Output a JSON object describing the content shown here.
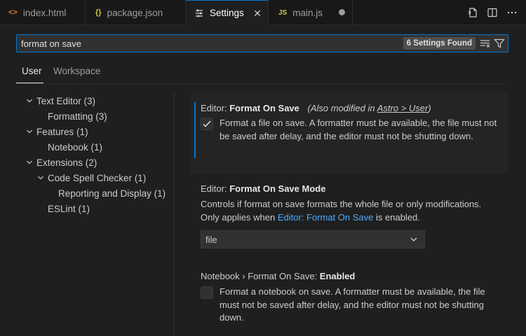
{
  "tabs": [
    {
      "label": "index.html",
      "icon": "<>",
      "icon_color": "#e37933"
    },
    {
      "label": "package.json",
      "icon": "{}",
      "icon_color": "#cbcb41"
    },
    {
      "label": "Settings",
      "icon": "settings-icon",
      "active": true
    },
    {
      "label": "main.js",
      "icon": "JS",
      "icon_color": "#cbcb41",
      "modified": true
    }
  ],
  "search": {
    "value": "format on save",
    "result_count": "6 Settings Found"
  },
  "scope": {
    "user": "User",
    "workspace": "Workspace"
  },
  "toc": [
    {
      "label": "Text Editor (3)",
      "expanded": true,
      "level": 0
    },
    {
      "label": "Formatting (3)",
      "level": 1
    },
    {
      "label": "Features (1)",
      "expanded": true,
      "level": 0
    },
    {
      "label": "Notebook (1)",
      "level": 1
    },
    {
      "label": "Extensions (2)",
      "expanded": true,
      "level": 0
    },
    {
      "label": "Code Spell Checker (1)",
      "expanded": true,
      "level": 1
    },
    {
      "label": "Reporting and Display (1)",
      "level": 2
    },
    {
      "label": "ESLint (1)",
      "level": 1
    }
  ],
  "settings": {
    "format_on_save": {
      "category": "Editor: ",
      "name": "Format On Save",
      "also_prefix": "(Also modified in ",
      "also_link": "Astro > User",
      "also_suffix": ")",
      "description": "Format a file on save. A formatter must be available, the file must not be saved after delay, and the editor must not be shutting down.",
      "checked": true
    },
    "format_on_save_mode": {
      "category": "Editor: ",
      "name": "Format On Save Mode",
      "desc_line1": "Controls if format on save formats the whole file or only modifications.",
      "desc_pre": "Only applies when ",
      "desc_link": "Editor: Format On Save",
      "desc_post": " is enabled.",
      "value": "file"
    },
    "notebook_format_on_save": {
      "category": "Notebook › Format On Save: ",
      "name": "Enabled",
      "description": "Format a notebook on save. A formatter must be available, the file must not be saved after delay, and the editor must not be shutting down.",
      "checked": false
    }
  },
  "colors": {
    "accent": "#0078d4",
    "link": "#4daafc",
    "background": "#1f1f1f"
  }
}
